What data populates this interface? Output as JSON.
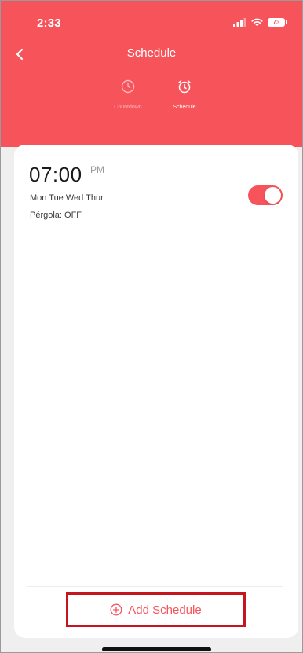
{
  "colors": {
    "accent": "#f6535a",
    "highlight_border": "#c4161c",
    "background": "#efefef",
    "card": "#ffffff"
  },
  "status_bar": {
    "time": "2:33",
    "battery": "73",
    "icons": [
      "signal-icon",
      "wifi-icon",
      "battery-icon"
    ]
  },
  "header": {
    "title": "Schedule",
    "back_icon": "chevron-left-icon"
  },
  "tabs": [
    {
      "label": "Countdown",
      "icon": "clock-icon",
      "active": false
    },
    {
      "label": "Schedule",
      "icon": "alarm-clock-icon",
      "active": true
    }
  ],
  "schedules": [
    {
      "time": "07:00",
      "period": "PM",
      "days": "Mon Tue Wed Thur",
      "action": "Pérgola: OFF",
      "enabled": true
    }
  ],
  "footer": {
    "add_label": "Add Schedule",
    "add_icon": "plus-circle-icon"
  }
}
